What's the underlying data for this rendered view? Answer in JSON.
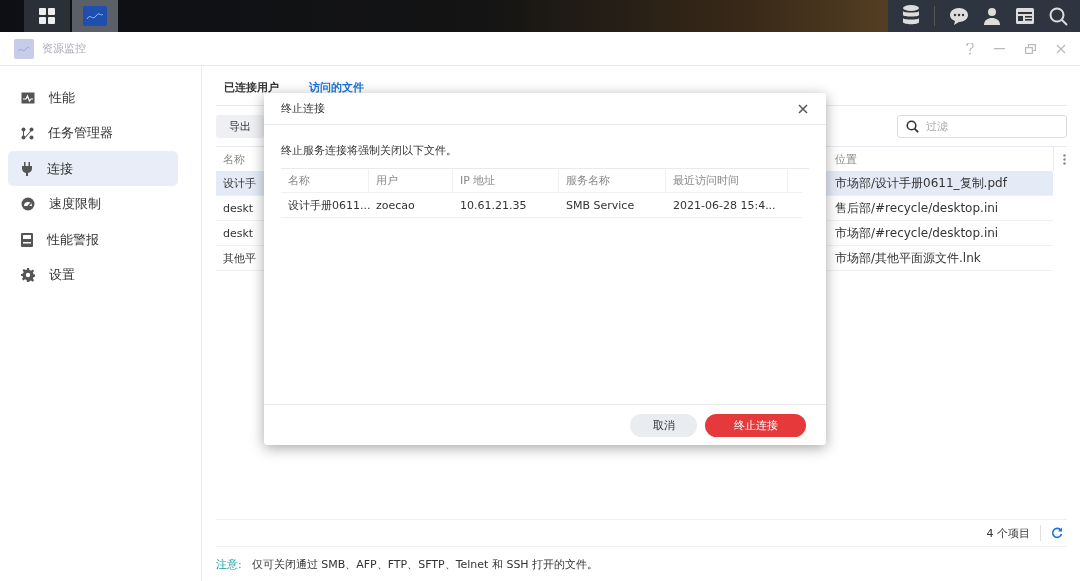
{
  "window": {
    "title": "资源监控"
  },
  "sidebar": {
    "items": [
      {
        "label": "性能",
        "selected": false
      },
      {
        "label": "任务管理器",
        "selected": false
      },
      {
        "label": "连接",
        "selected": true
      },
      {
        "label": "速度限制",
        "selected": false
      },
      {
        "label": "性能警报",
        "selected": false
      },
      {
        "label": "设置",
        "selected": false
      }
    ]
  },
  "tabs": [
    {
      "label": "已连接用户",
      "selected": false
    },
    {
      "label": "访问的文件",
      "selected": true
    }
  ],
  "toolbar": {
    "export_button": "导出",
    "filter": {
      "placeholder": "过滤"
    }
  },
  "table": {
    "columns": [
      "名称",
      "位置"
    ],
    "rows": [
      {
        "name": "设计手",
        "location": "市场部/设计手册0611_复制.pdf",
        "selected": true
      },
      {
        "name": "deskt",
        "location": "售后部/#recycle/desktop.ini",
        "selected": false
      },
      {
        "name": "deskt",
        "location": "市场部/#recycle/desktop.ini",
        "selected": false
      },
      {
        "name": "其他平",
        "location": "市场部/其他平面源文件.lnk",
        "selected": false
      }
    ]
  },
  "footer": {
    "count": "4 个项目"
  },
  "note": {
    "label": "注意:",
    "text": "仅可关闭通过 SMB、AFP、FTP、SFTP、Telnet 和 SSH 打开的文件。"
  },
  "dialog": {
    "title": "终止连接",
    "message": "终止服务连接将强制关闭以下文件。",
    "columns": [
      "名称",
      "用户",
      "IP 地址",
      "服务名称",
      "最近访问时间"
    ],
    "rows": [
      [
        "设计手册0611...",
        "zoecao",
        "10.61.21.35",
        "SMB Service",
        "2021-06-28 15:4..."
      ]
    ],
    "buttons": [
      {
        "label": "取消",
        "kind": "secondary"
      },
      {
        "label": "终止连接",
        "kind": "danger"
      }
    ]
  }
}
